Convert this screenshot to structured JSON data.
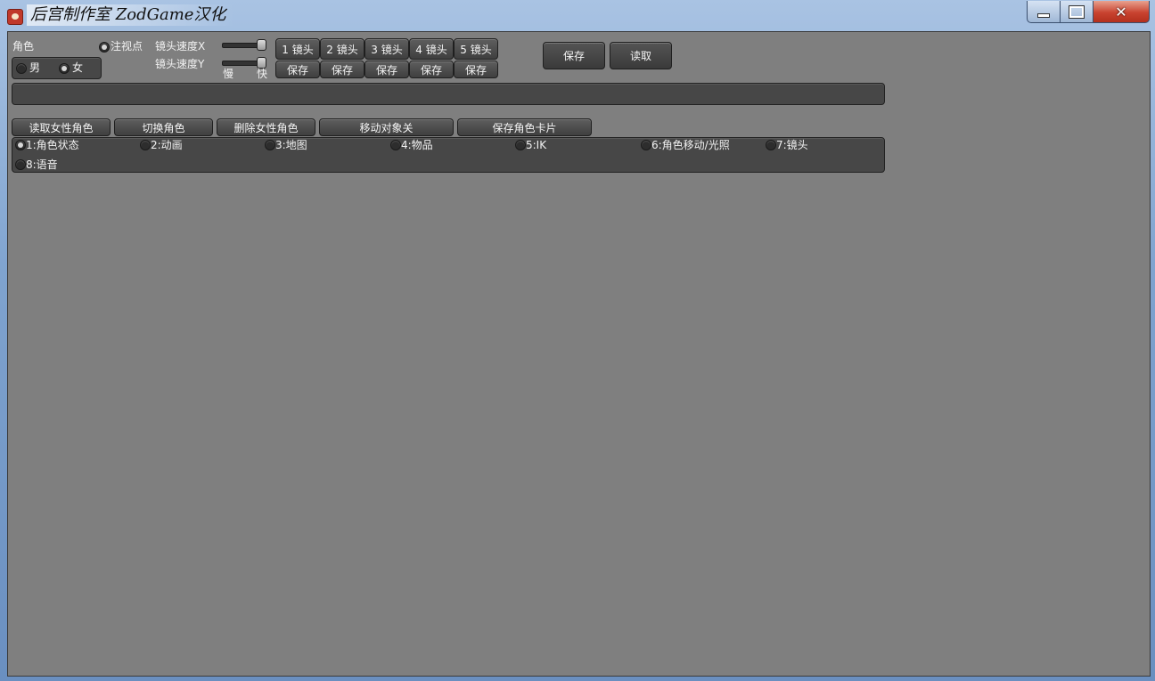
{
  "window": {
    "title": "后宫制作室 ZodGame汉化",
    "minimize_label": "",
    "maximize_label": "",
    "close_glyph": "✕"
  },
  "character": {
    "label": "角色",
    "male": "男",
    "female": "女",
    "selected": "女",
    "focus_point": "注视点"
  },
  "camera": {
    "speed_x_label": "镜头速度X",
    "speed_y_label": "镜头速度Y",
    "slow_label": "慢",
    "fast_label": "快",
    "speed_x_value": 1.0,
    "speed_y_value": 1.0,
    "slots": [
      "1 镜头",
      "2 镜头",
      "3 镜头",
      "4 镜头",
      "5 镜头"
    ],
    "save_labels": [
      "保存",
      "保存",
      "保存",
      "保存",
      "保存"
    ]
  },
  "scene": {
    "save_label": "保存",
    "load_label": "读取",
    "input_value": ""
  },
  "actions": {
    "load_female": "读取女性角色",
    "switch_character": "切换角色",
    "delete_female": "删除女性角色",
    "move_object": "移动对象关",
    "save_card": "保存角色卡片"
  },
  "tabs": [
    {
      "label": "1:角色状态",
      "selected": true
    },
    {
      "label": "2:动画",
      "selected": false
    },
    {
      "label": "3:地图",
      "selected": false
    },
    {
      "label": "4:物品",
      "selected": false
    },
    {
      "label": "5:IK",
      "selected": false
    },
    {
      "label": "6:角色移动/光照",
      "selected": false
    },
    {
      "label": "7:镜头",
      "selected": false
    },
    {
      "label": "8:语音",
      "selected": false
    }
  ]
}
